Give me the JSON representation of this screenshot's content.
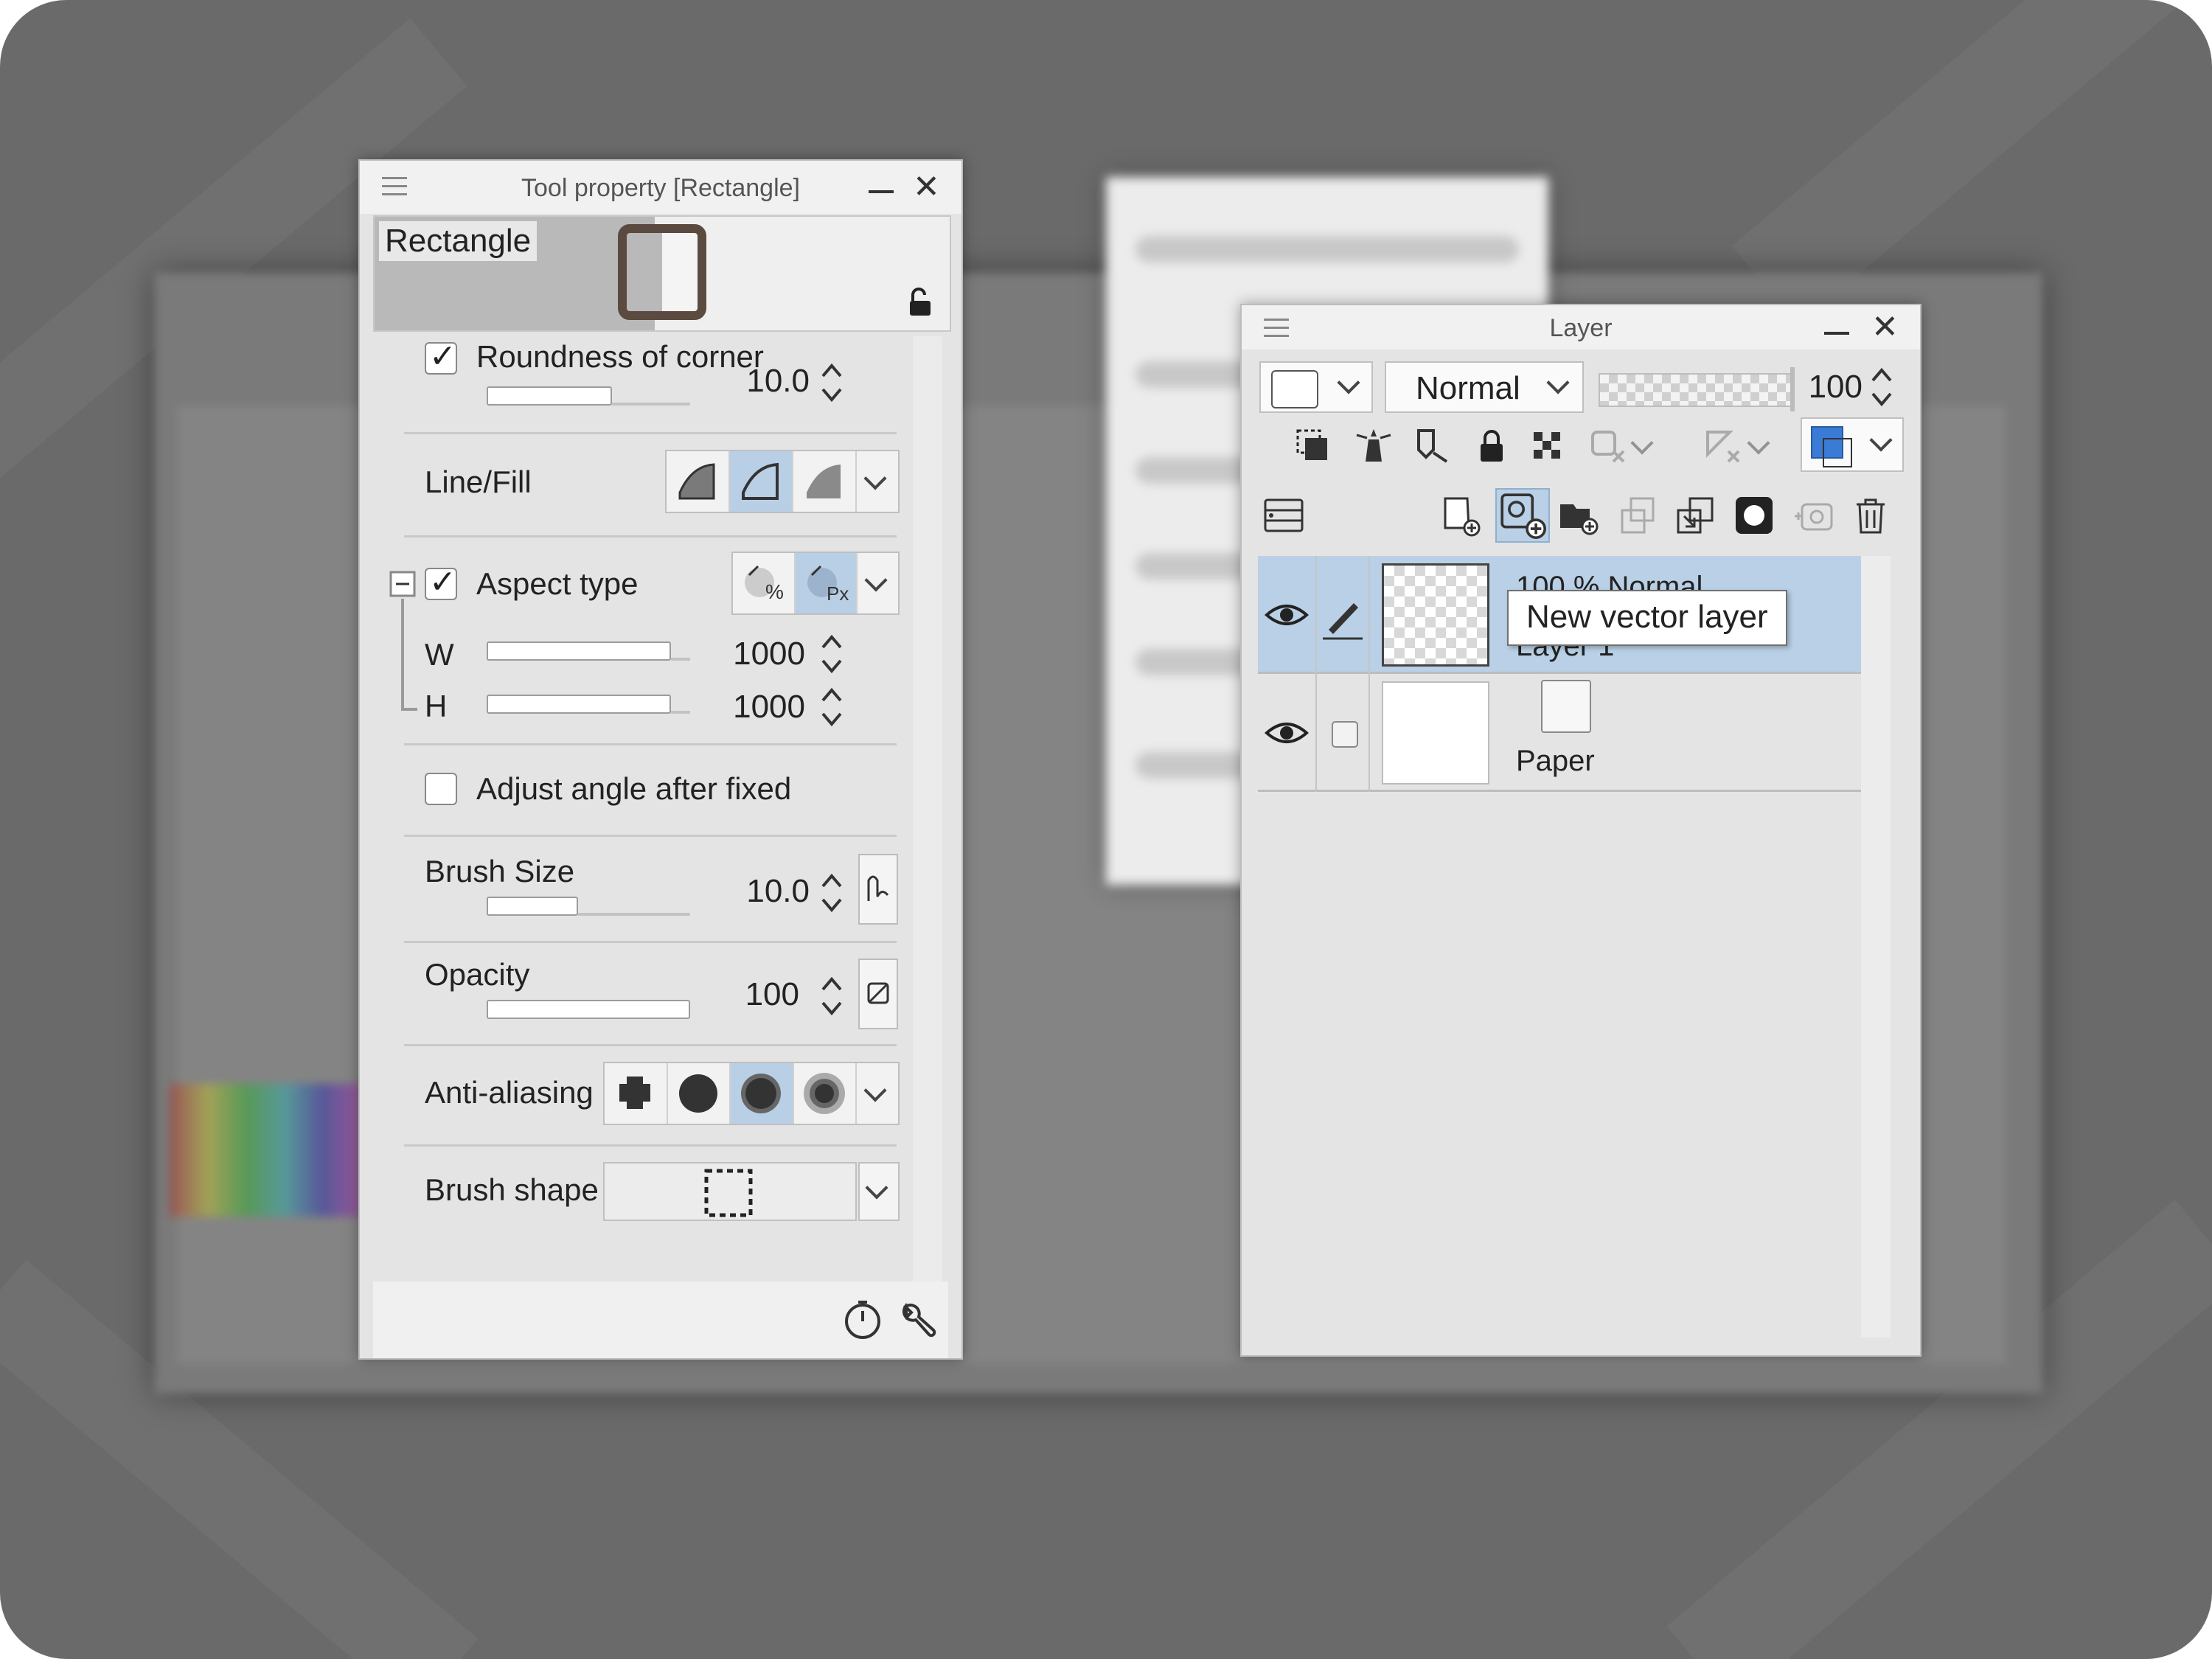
{
  "tool_property": {
    "title": "Tool property [Rectangle]",
    "preview_name": "Rectangle",
    "roundness": {
      "label": "Roundness of corner",
      "value": "10.0",
      "checked": true,
      "level": 0.45
    },
    "line_fill": {
      "label": "Line/Fill",
      "options": [
        "line-fill-icon",
        "line-icon",
        "fill-icon"
      ],
      "selected": 1
    },
    "aspect": {
      "label": "Aspect type",
      "checked": true,
      "options": [
        "percent-aspect-icon",
        "pixel-aspect-icon"
      ],
      "selected": 1
    },
    "width": {
      "label": "W",
      "value": "1000",
      "level": 0.95
    },
    "height": {
      "label": "H",
      "value": "1000",
      "level": 0.95
    },
    "adjust_angle": {
      "label": "Adjust angle after fixed",
      "checked": false
    },
    "brush_size": {
      "label": "Brush Size",
      "value": "10.0",
      "level": 0.45
    },
    "opacity": {
      "label": "Opacity",
      "value": "100",
      "level": 1.0
    },
    "anti_aliasing": {
      "label": "Anti-aliasing",
      "options": [
        "none",
        "weak",
        "medium",
        "strong"
      ],
      "selected": 2
    },
    "brush_shape": {
      "label": "Brush shape"
    }
  },
  "layer_panel": {
    "title": "Layer",
    "blend_mode": "Normal",
    "opacity": "100",
    "tooltip": "New vector layer",
    "layers": [
      {
        "line1": "100 % Normal",
        "line2": "Layer 1",
        "selected": true,
        "thumb": "checker"
      },
      {
        "line1": "",
        "line2": "Paper",
        "selected": false,
        "thumb": "white"
      }
    ],
    "colors": {
      "selection": "#b9d0e6",
      "layer_color": "#3a7bd5"
    }
  }
}
